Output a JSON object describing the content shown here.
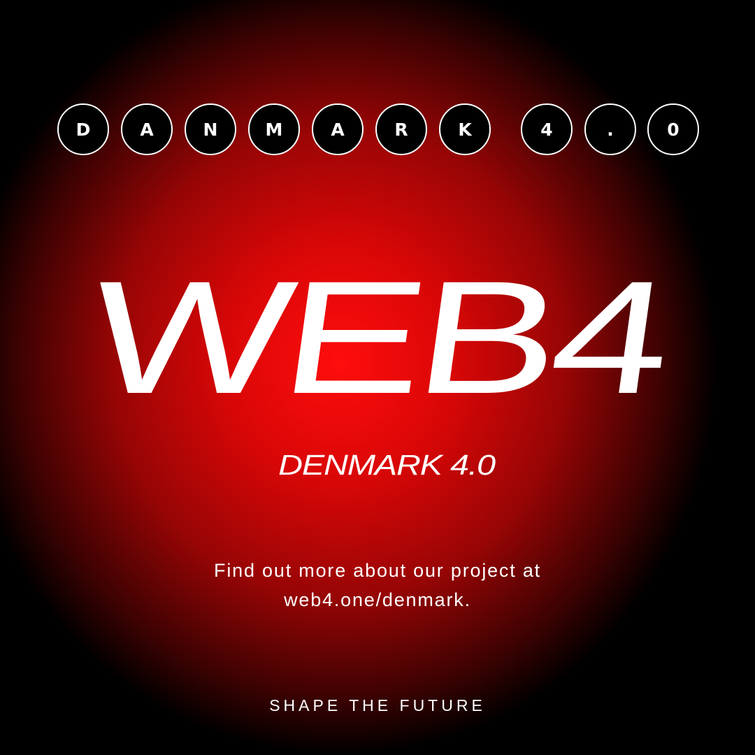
{
  "banner": {
    "letters": [
      "D",
      "A",
      "N",
      "M",
      "A",
      "R",
      "K",
      "4",
      ".",
      "0"
    ]
  },
  "title": "WEB4",
  "subtitle": "DENMARK 4.0",
  "info": {
    "line1": "Find out more about our project at",
    "line2": "web4.one/denmark."
  },
  "tagline": "SHAPE THE FUTURE",
  "colors": {
    "background": "#000000",
    "glow_center": "#ff0d0d",
    "text": "#ffffff"
  }
}
